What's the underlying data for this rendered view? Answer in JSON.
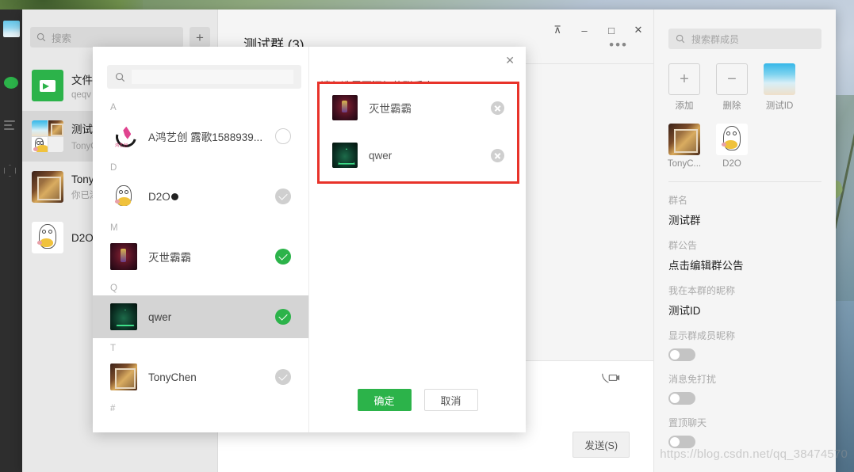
{
  "window": {
    "title": "测试群 (3)",
    "controls": {
      "pin": "⊼",
      "minimize": "–",
      "maximize": "□",
      "close": "✕"
    },
    "more_menu": "•••"
  },
  "rail": {
    "items": [
      {
        "name": "profile-avatar",
        "label": ""
      },
      {
        "name": "chats",
        "label": ""
      },
      {
        "name": "contacts",
        "label": ""
      },
      {
        "name": "favorites",
        "label": ""
      }
    ]
  },
  "chat_list": {
    "search_placeholder": "搜索",
    "add_button": "+",
    "rows": [
      {
        "name": "文件传输助手",
        "preview": "qeqv",
        "avatar": "file-transfer",
        "selected": false
      },
      {
        "name": "测试群",
        "preview": "TonyChen：",
        "avatar": "group-quad",
        "selected": true
      },
      {
        "name": "TonyChen",
        "preview": "你已添...",
        "avatar": "photo",
        "selected": false
      },
      {
        "name": "D2O",
        "preview": "",
        "avatar": "duck",
        "selected": false
      }
    ]
  },
  "conversation": {
    "send_button": "发送(S)",
    "video_call_icon": "video-call-icon"
  },
  "info_panel": {
    "search_placeholder": "搜索群成员",
    "members": [
      {
        "label": "添加",
        "avatar": "plus"
      },
      {
        "label": "删除",
        "avatar": "minus"
      },
      {
        "label": "测试ID",
        "avatar": "beach"
      },
      {
        "label": "TonyC...",
        "avatar": "photo"
      },
      {
        "label": "D2O",
        "avatar": "duck"
      }
    ],
    "fields": [
      {
        "label": "群名",
        "value": "测试群",
        "type": "text"
      },
      {
        "label": "群公告",
        "value": "点击编辑群公告",
        "type": "text"
      },
      {
        "label": "我在本群的昵称",
        "value": "测试ID",
        "type": "text"
      },
      {
        "label": "显示群成员昵称",
        "value": "",
        "type": "toggle",
        "on": false
      },
      {
        "label": "消息免打扰",
        "value": "",
        "type": "toggle",
        "on": false
      },
      {
        "label": "置顶聊天",
        "value": "",
        "type": "toggle",
        "on": false
      }
    ]
  },
  "modal": {
    "close_icon": "✕",
    "search_value": "",
    "hint": "请勾选需要添加的联系人",
    "groups": [
      {
        "letter": "A",
        "contacts": [
          {
            "name": "A鸿艺创  露歌1588939...",
            "avatar": "ahong",
            "state": "empty"
          }
        ]
      },
      {
        "letter": "D",
        "contacts": [
          {
            "name": "D2O",
            "avatar": "duck",
            "state": "disabled",
            "has_dot": true
          }
        ]
      },
      {
        "letter": "M",
        "contacts": [
          {
            "name": "灭世霸霸",
            "avatar": "hero",
            "state": "on"
          }
        ]
      },
      {
        "letter": "Q",
        "contacts": [
          {
            "name": "qwer",
            "avatar": "grid",
            "state": "on",
            "hover": true
          }
        ]
      },
      {
        "letter": "T",
        "contacts": [
          {
            "name": "TonyChen",
            "avatar": "photo",
            "state": "disabled"
          }
        ]
      },
      {
        "letter": "#",
        "contacts": []
      }
    ],
    "selected": [
      {
        "name": "灭世霸霸",
        "avatar": "hero"
      },
      {
        "name": "qwer",
        "avatar": "grid"
      }
    ],
    "confirm_label": "确定",
    "cancel_label": "取消",
    "highlight_color": "#e8332a"
  },
  "watermark": "https://blog.csdn.net/qq_38474570"
}
